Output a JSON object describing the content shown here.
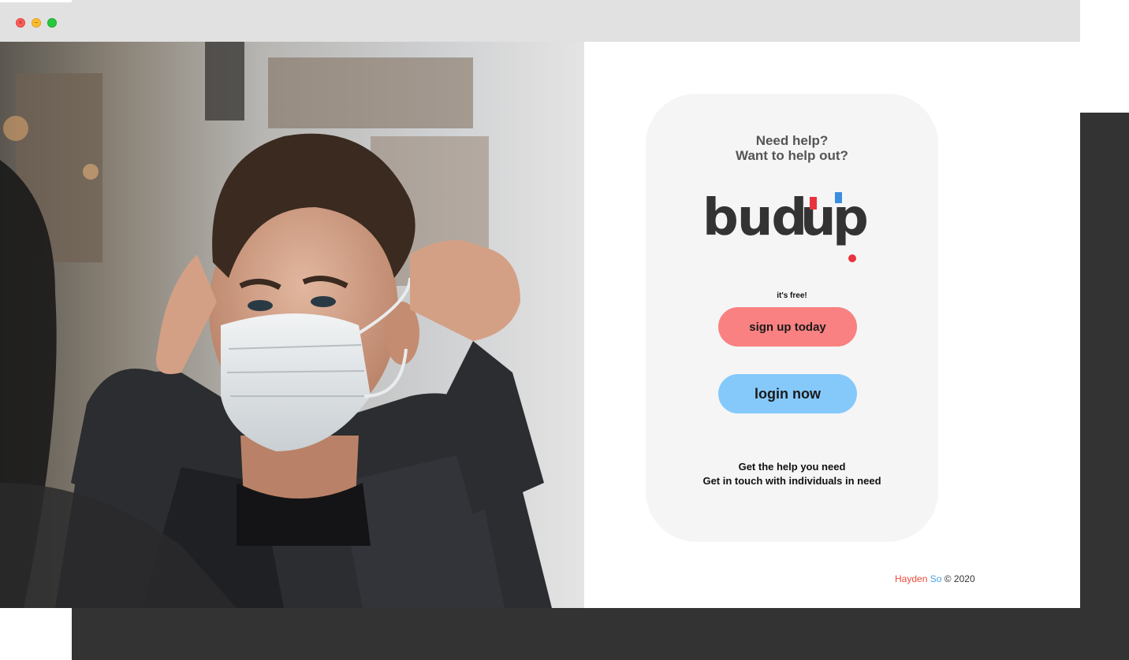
{
  "window": {
    "controls": [
      "close-icon",
      "minimize-icon",
      "maximize-icon"
    ],
    "colors": {
      "close": "#fe5f57",
      "minimize": "#febc2e",
      "maximize": "#28c840"
    }
  },
  "card": {
    "headline_line1": "Need help?",
    "headline_line2": "Want to help out?",
    "logo_text": "budup",
    "free_note": "it's free!",
    "signup_label": "sign up today",
    "login_label": "login now",
    "tagline_line1": "Get the help you need",
    "tagline_line2": "Get in touch with individuals in need"
  },
  "footer": {
    "first": "Hayden",
    "last": "So",
    "copyright": "© 2020"
  },
  "colors": {
    "signup": "#f98181",
    "login": "#85c9fb",
    "accent_red": "#e8333c",
    "accent_blue": "#3b8de0",
    "dark": "#333333"
  }
}
